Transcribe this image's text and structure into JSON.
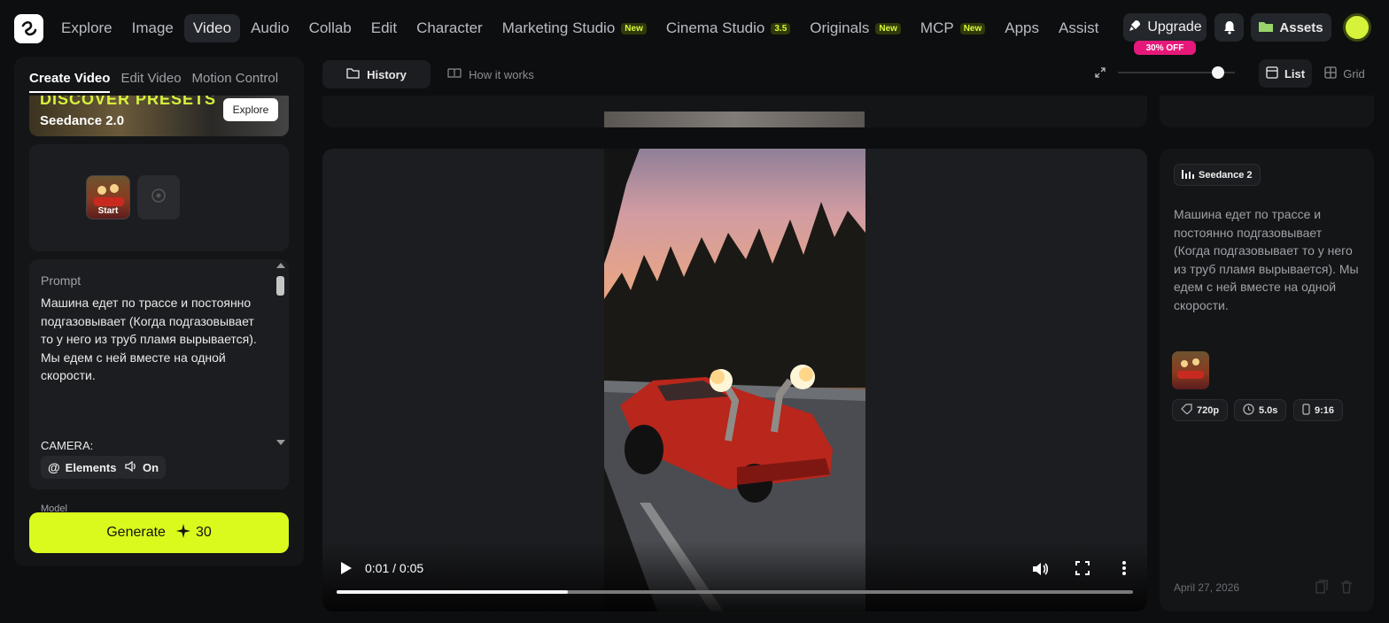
{
  "nav": {
    "items": [
      {
        "label": "Explore"
      },
      {
        "label": "Image"
      },
      {
        "label": "Video",
        "active": true
      },
      {
        "label": "Audio"
      },
      {
        "label": "Collab"
      },
      {
        "label": "Edit"
      },
      {
        "label": "Character"
      },
      {
        "label": "Marketing Studio",
        "badge": "New"
      },
      {
        "label": "Cinema Studio",
        "badge": "3.5"
      },
      {
        "label": "Originals",
        "badge": "New"
      },
      {
        "label": "MCP",
        "badge": "New"
      },
      {
        "label": "Apps"
      },
      {
        "label": "Assist"
      }
    ],
    "upgrade_label": "Upgrade",
    "discount": "30% OFF",
    "assets_label": "Assets"
  },
  "left_panel": {
    "tabs": [
      "Create Video",
      "Edit Video",
      "Motion Control"
    ],
    "promo": {
      "headline": "DISCOVER PRESETS",
      "model": "Seedance 2.0",
      "button": "Explore"
    },
    "start_frame_label": "Start",
    "prompt_label": "Prompt",
    "prompt_text": "Машина едет по трассе и постоянно подгазовывает (Когда подгазовывает то у него из труб пламя вырывается). Мы едем с ней вместе на одной скорости.",
    "camera_text": "CAMERA:",
    "chips": {
      "elements": "Elements",
      "audio": "On"
    },
    "model_label": "Model",
    "generate": {
      "label": "Generate",
      "cost": "30"
    }
  },
  "center": {
    "history_tab": "History",
    "how_tab": "How it works",
    "view_list": "List",
    "view_grid": "Grid",
    "zoom_level": 0.9
  },
  "player": {
    "time": "0:01 / 0:05",
    "progress": 0.29
  },
  "info": {
    "model": "Seedance 2",
    "prompt": "Машина едет по трассе и постоянно подгазовывает (Когда подгазовывает то у него из труб пламя вырывается). Мы едем с ней вместе на одной скорости.",
    "resolution": "720p",
    "duration": "5.0s",
    "aspect": "9:16",
    "date": "April 27, 2026"
  },
  "colors": {
    "accent": "#dafa1e",
    "discount": "#e6197a",
    "background": "#0d0e10"
  }
}
